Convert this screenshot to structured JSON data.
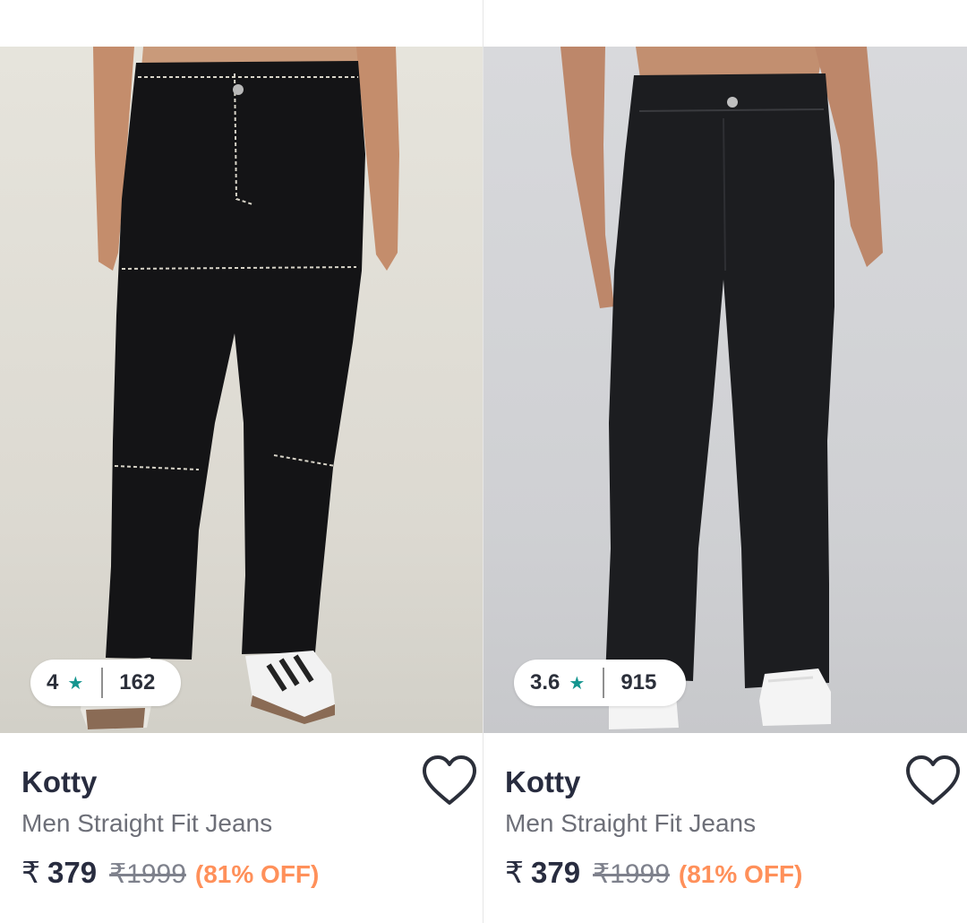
{
  "products": [
    {
      "rating": "4",
      "rating_icon": "star-icon",
      "rating_count": "162",
      "brand": "Kotty",
      "name": "Men Straight Fit Jeans",
      "currency": "₹",
      "price": "379",
      "mrp": "₹1999",
      "discount": "(81% OFF)",
      "wishlist_icon": "heart-outline-icon"
    },
    {
      "rating": "3.6",
      "rating_icon": "star-icon",
      "rating_count": "915",
      "brand": "Kotty",
      "name": "Men Straight Fit Jeans",
      "currency": "₹",
      "price": "379",
      "mrp": "₹1999",
      "discount": "(81% OFF)",
      "wishlist_icon": "heart-outline-icon"
    }
  ],
  "colors": {
    "star": "#14958f",
    "discount": "#ff905a",
    "brand_text": "#282c3f",
    "muted_text": "#6d6f78"
  }
}
